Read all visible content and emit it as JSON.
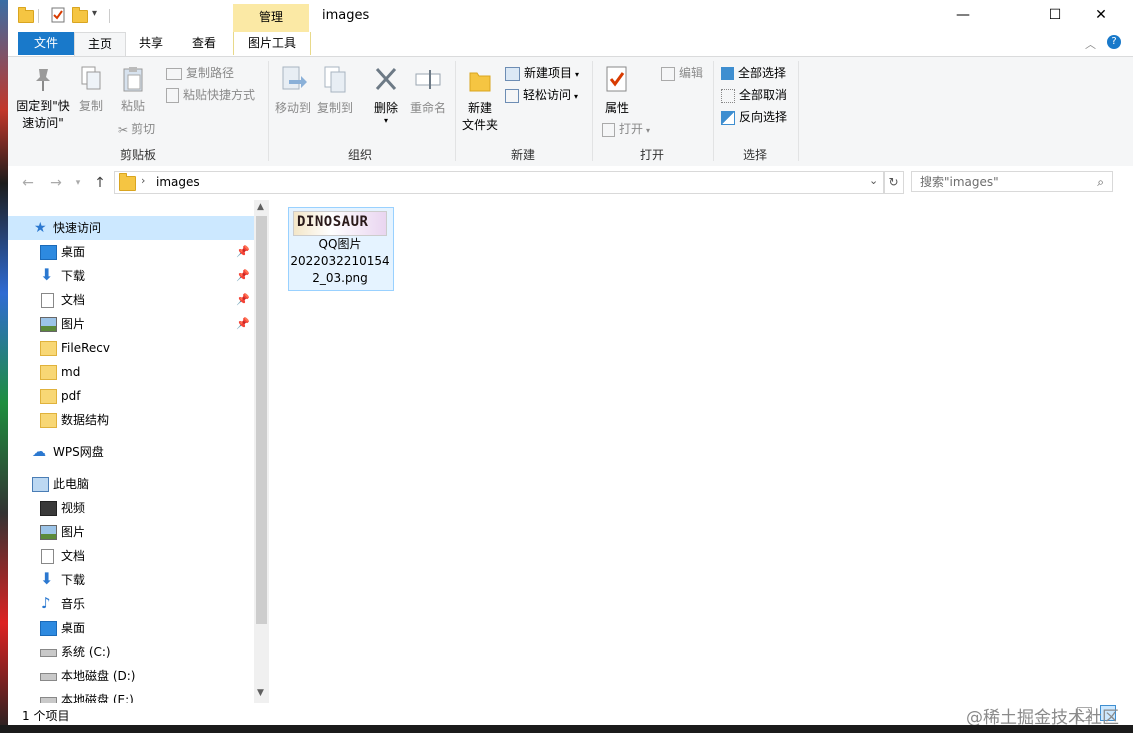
{
  "window": {
    "title": "images",
    "contextual_tab_header": "管理",
    "minimize_glyph": "—",
    "maximize_glyph": "☐",
    "close_glyph": "✕"
  },
  "ribbon_tabs": {
    "file": "文件",
    "home": "主页",
    "share": "共享",
    "view": "查看",
    "picture_tools": "图片工具"
  },
  "ribbon": {
    "clipboard": {
      "pin_label_1": "固定到\"快",
      "pin_label_2": "速访问\"",
      "copy": "复制",
      "paste": "粘贴",
      "copy_path": "复制路径",
      "paste_shortcut": "粘贴快捷方式",
      "cut": "剪切",
      "group": "剪贴板"
    },
    "organize": {
      "move_to": "移动到",
      "copy_to": "复制到",
      "delete": "删除",
      "rename": "重命名",
      "group": "组织"
    },
    "new": {
      "new_folder_1": "新建",
      "new_folder_2": "文件夹",
      "new_item": "新建项目",
      "easy_access": "轻松访问",
      "group": "新建"
    },
    "open": {
      "properties": "属性",
      "open": "打开",
      "edit": "编辑",
      "group": "打开"
    },
    "select": {
      "select_all": "全部选择",
      "select_none": "全部取消",
      "invert": "反向选择",
      "group": "选择"
    }
  },
  "address": {
    "path": "images",
    "search_placeholder": "搜索\"images\""
  },
  "nav": {
    "quick_access": "快速访问",
    "items": [
      "桌面",
      "下载",
      "文档",
      "图片",
      "FileRecv",
      "md",
      "pdf",
      "数据结构"
    ],
    "wps": "WPS网盘",
    "this_pc": "此电脑",
    "pc_items": [
      "视频",
      "图片",
      "文档",
      "下载",
      "音乐",
      "桌面",
      "系统 (C:)",
      "本地磁盘 (D:)",
      "本地磁盘 (E:)"
    ]
  },
  "files": [
    {
      "name_lines": [
        "QQ图片",
        "2022032210154",
        "2_03.png"
      ],
      "thumb_text": "DINOSAUR"
    }
  ],
  "status": {
    "count": "1 个项目"
  },
  "watermark": "@稀土掘金技术社区",
  "colors": {
    "file_tab": "#1979ca",
    "contextual_tab": "#fbe9a5",
    "selection": "#e5f3ff",
    "folder": "#f5c542"
  }
}
